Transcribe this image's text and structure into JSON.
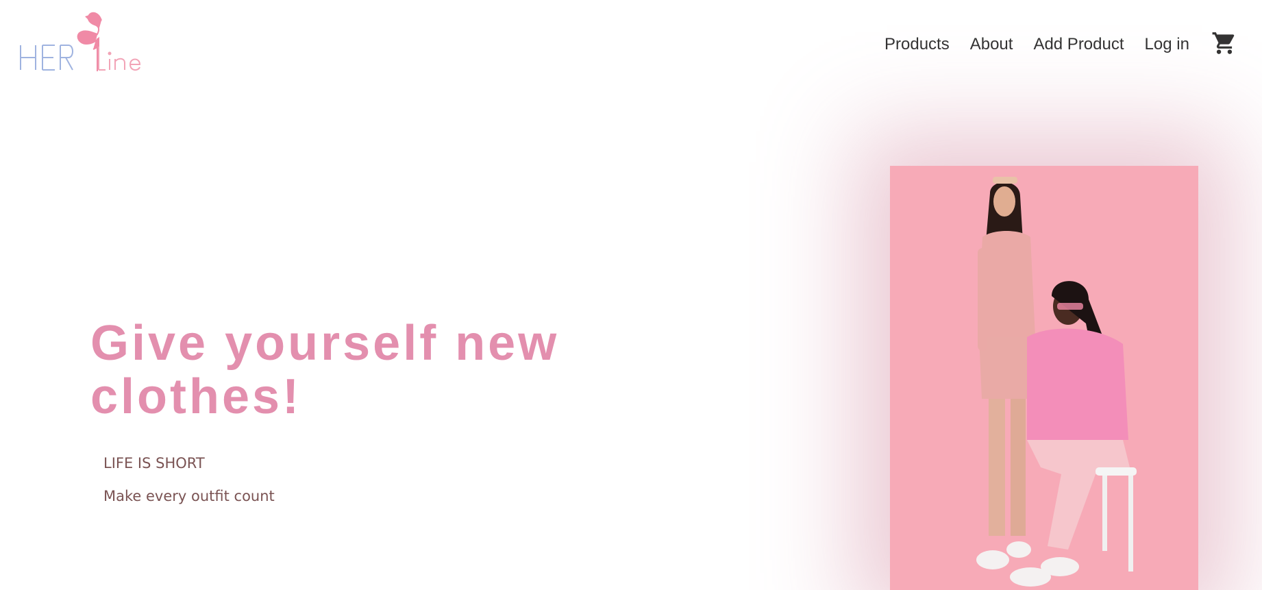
{
  "brand": {
    "logo_text_part1": "HER",
    "logo_text_part2": "Line",
    "logo_alt": "flamingo-logo",
    "colors": {
      "blue": "#9fb3e0",
      "pink": "#f2a3b6",
      "flamingo": "#f08aa6"
    }
  },
  "nav": {
    "items": [
      {
        "label": "Products"
      },
      {
        "label": "About"
      },
      {
        "label": "Add Product"
      },
      {
        "label": "Log in"
      }
    ],
    "cart_icon": "shopping-cart-icon"
  },
  "hero": {
    "title": "Give yourself new clothes!",
    "tagline": "LIFE IS SHORT",
    "subtagline": "Make every outfit count",
    "title_color": "#e38fae",
    "text_color": "#7a5353",
    "image_alt": "two-models-in-pink-outfits",
    "image_bg": "#f7aab7"
  }
}
